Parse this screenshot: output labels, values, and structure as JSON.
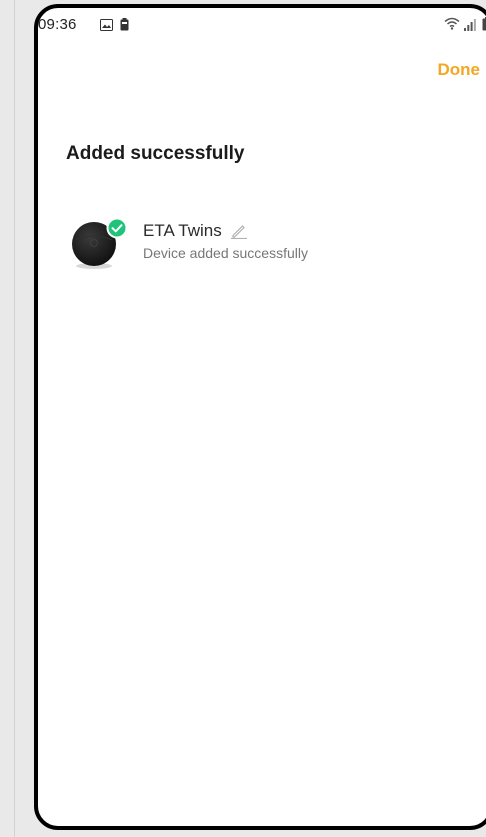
{
  "status_bar": {
    "time": "09:36",
    "icons": [
      "image-icon",
      "battery-small-icon",
      "wifi-icon",
      "signal-icon",
      "battery-icon"
    ]
  },
  "header": {
    "done_label": "Done"
  },
  "main": {
    "title": "Added successfully",
    "devices": [
      {
        "name": "ETA Twins",
        "status": "Device added successfully",
        "icon": "robot-vacuum-icon",
        "badge": "check-badge-icon"
      }
    ]
  },
  "colors": {
    "accent": "#f5a623",
    "success": "#1fc47a",
    "frame": "#000000"
  }
}
